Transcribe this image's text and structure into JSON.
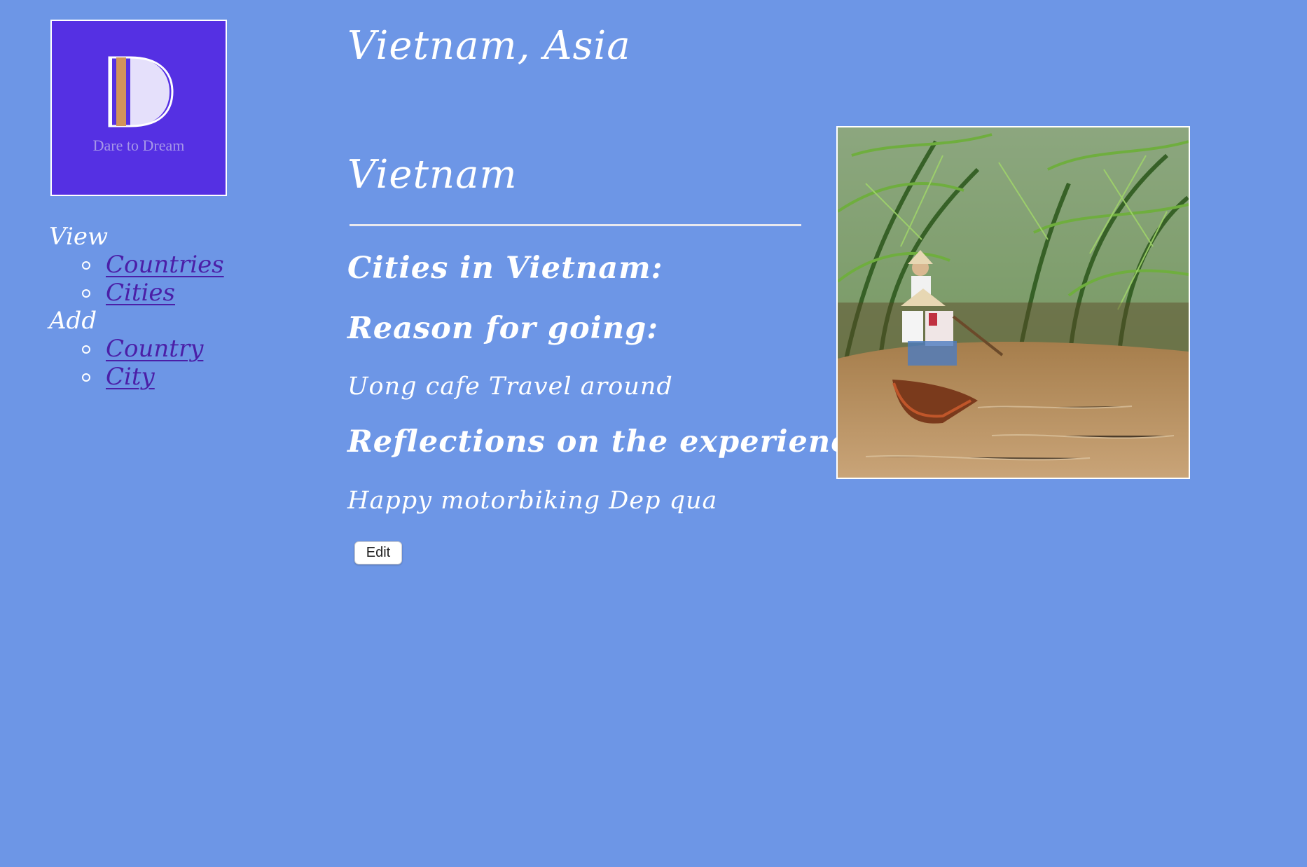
{
  "logo": {
    "brand_text": "Dare to Dream",
    "letter": "D"
  },
  "nav": {
    "view_label": "View",
    "view_items": [
      {
        "label": "Countries"
      },
      {
        "label": "Cities"
      }
    ],
    "add_label": "Add",
    "add_items": [
      {
        "label": "Country"
      },
      {
        "label": "City"
      }
    ]
  },
  "main": {
    "title": "Vietnam, Asia",
    "country_name": "Vietnam",
    "cities_heading": "Cities in Vietnam:",
    "reason_heading": "Reason for going:",
    "reason_text": "Uong cafe Travel around",
    "reflections_heading": "Reflections on the experience:",
    "reflections_text": "Happy motorbiking Dep qua",
    "edit_label": "Edit"
  },
  "colors": {
    "background": "#6d96e6",
    "logo_background": "#5530e3",
    "link": "#4b1fa7",
    "text": "#ffffff"
  }
}
